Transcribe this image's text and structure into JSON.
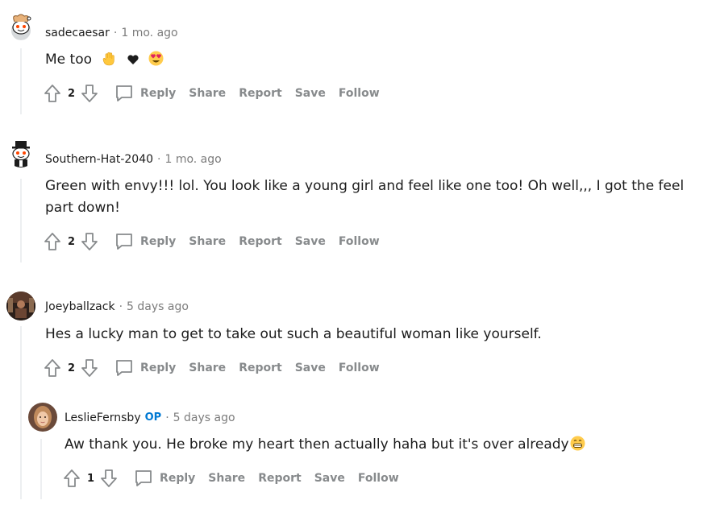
{
  "comments": [
    {
      "author": "sadecaesar",
      "is_op": false,
      "time": "1 mo. ago",
      "body": "Me too",
      "body_emojis": [
        "raised-hand-emoji",
        "black-heart-emoji",
        "heart-eyes-emoji"
      ],
      "score": "2",
      "avatar": "snoo-avatar"
    },
    {
      "author": "Southern-Hat-2040",
      "is_op": false,
      "time": "1 mo. ago",
      "body": "Green with envy!!! lol. You look like a young girl and feel like one too! Oh well,,, I got the feel part down!",
      "score": "2",
      "avatar": "snoo-top-hat-avatar"
    },
    {
      "author": "Joeyballzack",
      "is_op": false,
      "time": "5 days ago",
      "body": "Hes a lucky man to get to take out such a beautiful woman like yourself.",
      "score": "2",
      "avatar": "photo-avatar"
    },
    {
      "author": "LeslieFernsby",
      "is_op": true,
      "op_label": "OP",
      "time": "5 days ago",
      "body": "Aw thank you. He broke my heart then actually haha but it's over already",
      "body_emojis": [
        "grinning-emoji"
      ],
      "score": "1",
      "avatar": "photo-avatar"
    }
  ],
  "actions": {
    "reply": "Reply",
    "share": "Share",
    "report": "Report",
    "save": "Save",
    "follow": "Follow"
  },
  "separator": "·",
  "colors": {
    "op": "#0079d3",
    "meta": "#7c7c7c",
    "action": "#878a8c",
    "thread_line": "#edeff1"
  }
}
